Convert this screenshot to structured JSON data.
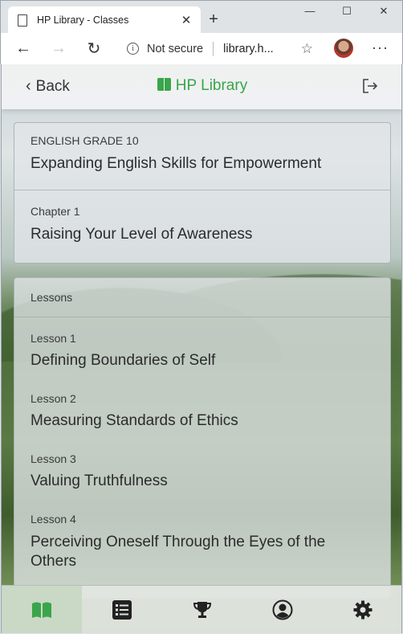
{
  "browser": {
    "tab_title": "HP Library - Classes",
    "tab_close": "✕",
    "new_tab": "+",
    "win_min": "—",
    "win_max": "☐",
    "win_close": "✕",
    "back": "←",
    "forward": "→",
    "reload": "↻",
    "security": "Not secure",
    "info_glyph": "i",
    "url": "library.h...",
    "star": "☆",
    "more": "···"
  },
  "header": {
    "back_label": "Back",
    "back_chevron": "‹",
    "brand": "HP Library"
  },
  "course": {
    "subject": "ENGLISH GRADE 10",
    "title": "Expanding English Skills for Empowerment",
    "chapter_label": "Chapter 1",
    "chapter_title": "Raising Your Level of Awareness"
  },
  "lessons": {
    "heading": "Lessons",
    "items": [
      {
        "label": "Lesson 1",
        "title": "Defining Boundaries of Self"
      },
      {
        "label": "Lesson 2",
        "title": "Measuring Standards of Ethics"
      },
      {
        "label": "Lesson 3",
        "title": "Valuing Truthfulness"
      },
      {
        "label": "Lesson 4",
        "title": "Perceiving Oneself Through the Eyes of the Others"
      }
    ]
  },
  "bottom_nav": {
    "items": [
      "library-icon",
      "list-icon",
      "trophy-icon",
      "profile-icon",
      "settings-icon"
    ],
    "active": "library-icon"
  },
  "colors": {
    "accent": "#3aa54a"
  }
}
